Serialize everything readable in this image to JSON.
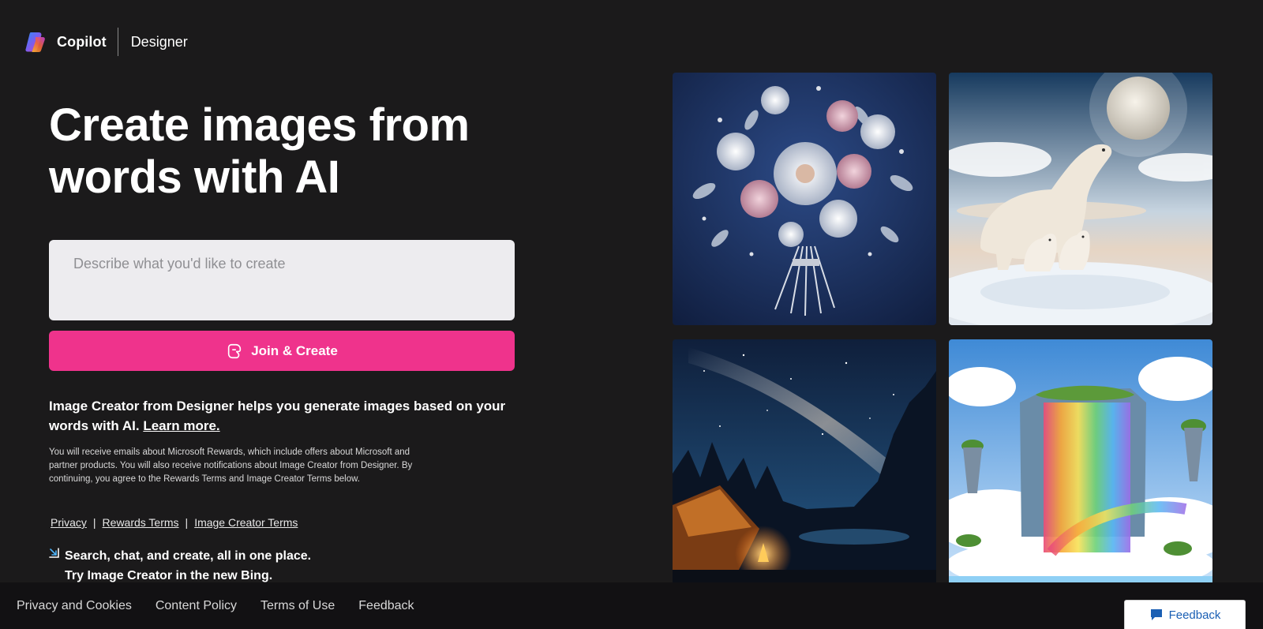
{
  "header": {
    "brand": "Copilot",
    "product": "Designer",
    "logo_icon": "copilot-logo-icon"
  },
  "hero": {
    "title_line1": "Create images from",
    "title_line2": "words with AI"
  },
  "prompt": {
    "placeholder": "Describe what you'd like to create",
    "value": ""
  },
  "join_button": {
    "label": "Join & Create",
    "icon": "copilot-outline-icon",
    "color": "#ef338c"
  },
  "description": {
    "text": "Image Creator from Designer helps you generate images based on your words with AI. ",
    "link": "Learn more."
  },
  "fine_print": "You will receive emails about Microsoft Rewards, which include offers about Microsoft and partner products. You will also receive notifications about Image Creator from Designer. By continuing, you agree to the Rewards Terms and Image Creator Terms below.",
  "legal_links": [
    {
      "label": "Privacy"
    },
    {
      "label": "Rewards Terms"
    },
    {
      "label": "Image Creator Terms"
    }
  ],
  "promo": {
    "line1": "Search, chat, and create, all in one place.",
    "line2": "Try Image Creator in the new Bing."
  },
  "gallery": [
    {
      "subject": "silver-flower-bouquet-image"
    },
    {
      "subject": "polar-bears-moon-image"
    },
    {
      "subject": "milky-way-campfire-image"
    },
    {
      "subject": "rainbow-waterfall-image"
    }
  ],
  "footer": {
    "links": [
      "Privacy and Cookies",
      "Content Policy",
      "Terms of Use",
      "Feedback"
    ]
  },
  "feedback_button": {
    "label": "Feedback",
    "icon": "feedback-chat-icon"
  },
  "colors": {
    "background": "#1b1a1b",
    "accent": "#ef338c",
    "footer": "#121113"
  }
}
